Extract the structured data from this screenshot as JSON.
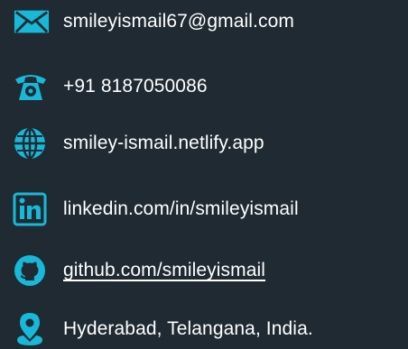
{
  "contacts": {
    "email": {
      "text": "smileyismail67@gmail.com",
      "icon": "mail-icon"
    },
    "phone": {
      "text": "+91 8187050086",
      "icon": "phone-icon"
    },
    "website": {
      "text": "smiley-ismail.netlify.app",
      "icon": "globe-icon"
    },
    "linkedin": {
      "text": "linkedin.com/in/smileyismail",
      "icon": "linkedin-icon"
    },
    "github": {
      "text": "github.com/smileyismail",
      "icon": "github-icon"
    },
    "location": {
      "text": "Hyderabad, Telangana, India.",
      "icon": "location-pin-icon"
    }
  },
  "colors": {
    "background": "#1f2a33",
    "icon_teal": "#18b8d8",
    "icon_dark": "#1f2a33",
    "text": "#ffffff"
  }
}
